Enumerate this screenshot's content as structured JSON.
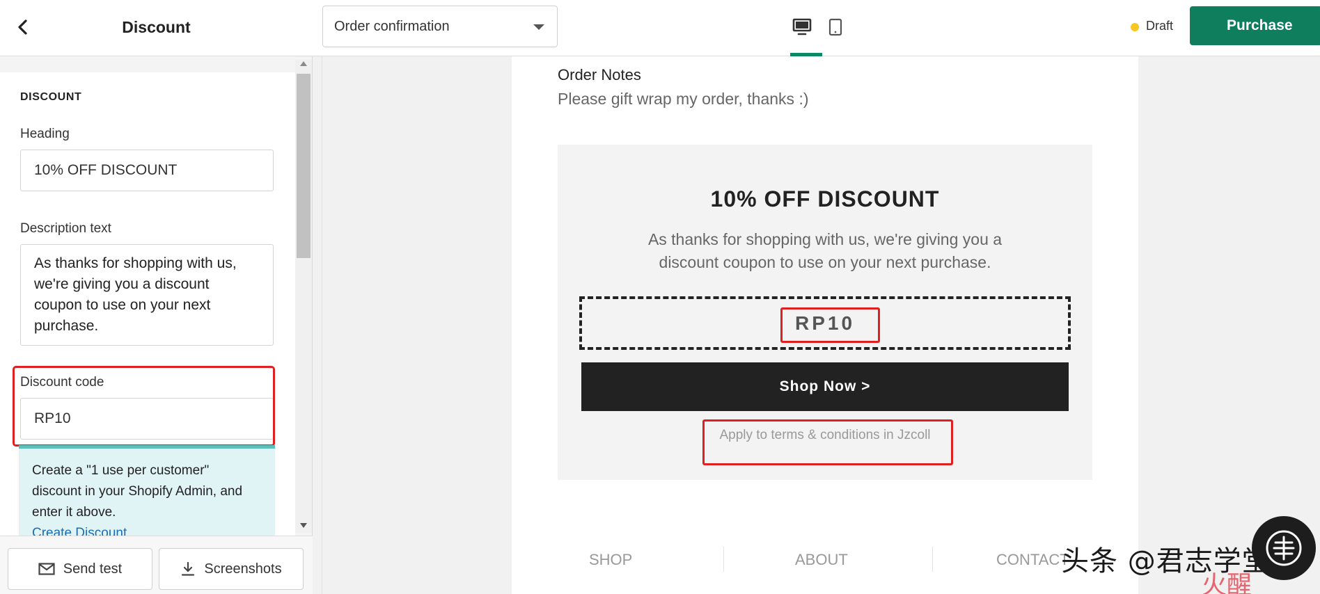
{
  "left_panel": {
    "title": "Discount",
    "section_title": "DISCOUNT",
    "heading_label": "Heading",
    "heading_value": "10% OFF DISCOUNT",
    "description_label": "Description text",
    "description_value": "As thanks for shopping with us, we're giving you a discount coupon to use on your next purchase.",
    "discount_code_label": "Discount code",
    "discount_code_value": "RP10",
    "info_text": "Create a \"1 use per customer\" discount in your Shopify Admin, and enter it above.",
    "create_link": "Create Discount",
    "send_test_label": "Send test",
    "screenshots_label": "Screenshots"
  },
  "topbar": {
    "template_select": "Order confirmation",
    "status_label": "Draft",
    "purchase_label": "Purchase",
    "view_modes": [
      "desktop",
      "mobile"
    ],
    "active_view": "desktop"
  },
  "preview": {
    "order_notes_label": "Order Notes",
    "order_notes_value": "Please gift wrap my order, thanks :)",
    "discount_heading": "10% OFF DISCOUNT",
    "discount_description": "As thanks for shopping with us, we're giving you a discount coupon to use on your next purchase.",
    "discount_code": "RP10",
    "shop_now_label": "Shop Now >",
    "terms_text": "Apply to terms & conditions in Jzcoll",
    "footer_links": [
      "SHOP",
      "ABOUT",
      "CONTACT"
    ]
  },
  "watermark": {
    "text": "头条 @君志学堂",
    "text2": "火醒"
  },
  "colors": {
    "accent": "#0e7e5d",
    "status_dot": "#f6c623",
    "highlight": "#e02020",
    "info_bg": "#e0f3f5",
    "info_border": "#5bbfba",
    "link": "#1a6db5"
  }
}
